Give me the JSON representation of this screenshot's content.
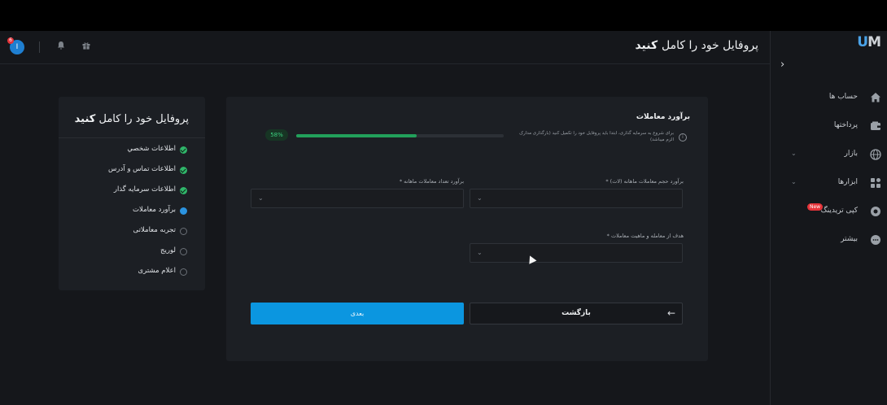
{
  "header": {
    "title_light": "پروفایل خود را کامل",
    "title_bold": "کنید",
    "avatar_letter": "I",
    "avatar_badge": "6"
  },
  "sidebar": {
    "logo_u": "U",
    "logo_m": "M",
    "items": [
      {
        "label": "حساب ها",
        "icon": "home-icon",
        "has_chevron": false
      },
      {
        "label": "پرداختها",
        "icon": "wallet-icon",
        "has_chevron": false
      },
      {
        "label": "بازار",
        "icon": "globe-icon",
        "has_chevron": true
      },
      {
        "label": "ابزارها",
        "icon": "tools-icon",
        "has_chevron": true
      },
      {
        "label": "کپی تریدینگ",
        "icon": "copy-trading-icon",
        "has_chevron": false,
        "badge": "New"
      },
      {
        "label": "بیشتر",
        "icon": "more-icon",
        "has_chevron": false
      }
    ]
  },
  "steps": {
    "title_light": "پروفایل خود را کامل",
    "title_bold": "کنید",
    "items": [
      {
        "label": "اطلاعات شخصي",
        "status": "done"
      },
      {
        "label": "اطلاعات تماس و آدرس",
        "status": "done"
      },
      {
        "label": "اطلاعات سرمایه گذار",
        "status": "done"
      },
      {
        "label": "برآورد معاملات",
        "status": "active"
      },
      {
        "label": "تجربه معاملاتی",
        "status": "pending"
      },
      {
        "label": "لوریج",
        "status": "pending"
      },
      {
        "label": "اعلام مشتری",
        "status": "pending"
      }
    ]
  },
  "form": {
    "title": "برآورد معاملات",
    "info_text": "برای شروع به سرمایه گذاری، ابتدا باید پروفایل خود را تکمیل کنید (بارگذاری مدارک الزم میباشد)",
    "progress_percent": 58,
    "progress_label": "58%",
    "fields": {
      "monthly_volume_label": "برآورد حجم معاملات ماهانه (لات) *",
      "monthly_count_label": "برآورد تعداد معاملات ماهانه *",
      "purpose_label": "هدف از معامله و ماهیت معاملات *"
    },
    "next_label": "بعدی",
    "back_label": "بازگشت"
  },
  "colors": {
    "accent": "#0b96e0",
    "success": "#2fb66a",
    "background": "#15171b",
    "card": "#1c1f24"
  }
}
